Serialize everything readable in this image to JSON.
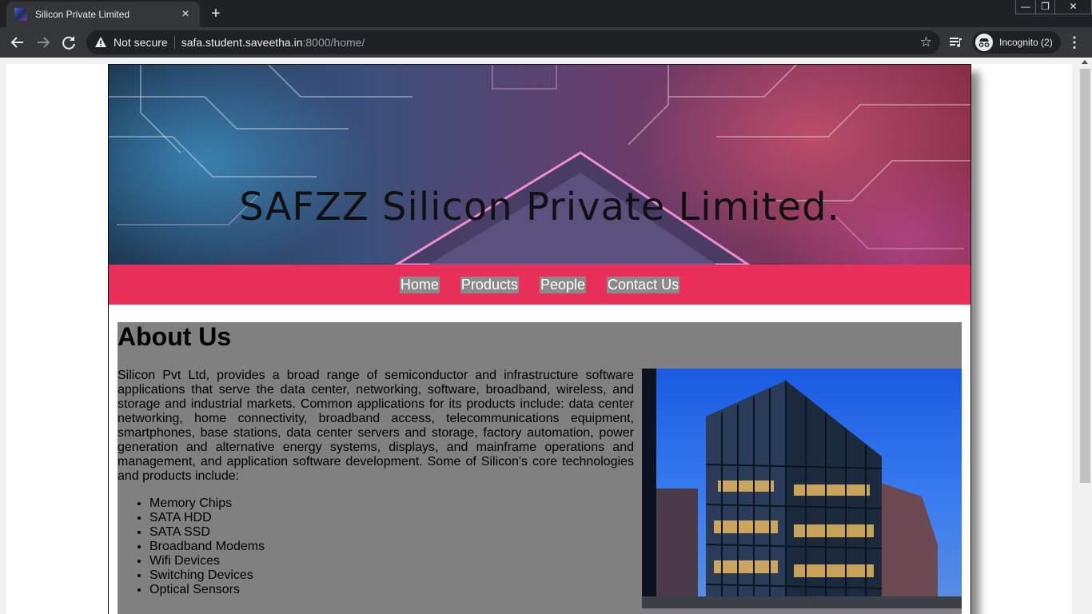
{
  "browser": {
    "tab_title": "Silicon Private Limited",
    "new_tab": "+",
    "close_tab": "×",
    "window_controls": {
      "minimize": "—",
      "restore": "❐",
      "close": "✕"
    },
    "security_label": "Not secure",
    "url_host": "safa.student.saveetha.in",
    "url_rest": ":8000/home/",
    "incognito_label": "Incognito (2)",
    "icons": [
      "back-icon",
      "forward-icon",
      "reload-icon",
      "warning-icon",
      "star-icon",
      "media-icon",
      "incognito-icon",
      "menu-icon"
    ]
  },
  "site": {
    "banner_title": "SAFZZ Silicon Private Limited.",
    "nav": [
      {
        "label": "Home"
      },
      {
        "label": "Products"
      },
      {
        "label": "People"
      },
      {
        "label": "Contact Us"
      }
    ],
    "about": {
      "title": "About Us",
      "paragraph": "Silicon Pvt Ltd, provides a broad range of semiconductor and infrastructure software applications that serve the data center, networking, software, broadband, wireless, and storage and industrial markets. Common applications for its products include: data center networking, home connectivity, broadband access, telecommunications equipment, smartphones, base stations, data center servers and storage, factory automation, power generation and alternative energy systems, displays, and mainframe operations and management, and application software development. Some of Silicon's core technologies and products include:",
      "items": [
        "Memory Chips",
        "SATA HDD",
        "SATA SSD",
        "Broadband Modems",
        "Wifi Devices",
        "Switching Devices",
        "Optical Sensors"
      ]
    }
  },
  "colors": {
    "navbar": "#ea305a",
    "nav_link_bg": "#8a8a8a",
    "content_bg": "#808080",
    "chrome_dark": "#202124",
    "chrome_mid": "#35363a"
  }
}
